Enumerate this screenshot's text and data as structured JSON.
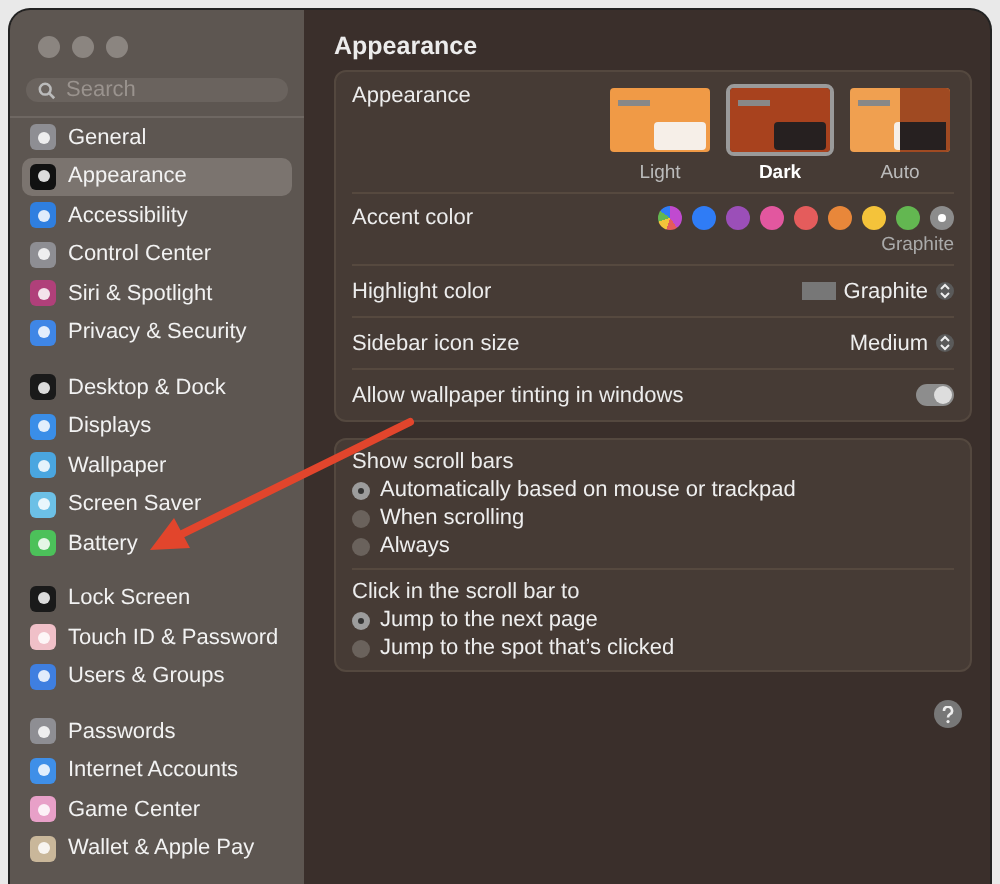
{
  "sidebar": {
    "search": {
      "placeholder": "Search"
    },
    "groups": [
      {
        "items": [
          {
            "label": "General",
            "color": "#8e8e93",
            "selected": false
          },
          {
            "label": "Appearance",
            "color": "#111111",
            "selected": true
          },
          {
            "label": "Accessibility",
            "color": "#2f7fe0",
            "selected": false
          },
          {
            "label": "Control Center",
            "color": "#8e8e93",
            "selected": false
          },
          {
            "label": "Siri & Spotlight",
            "color": "#b0407a",
            "selected": false
          },
          {
            "label": "Privacy & Security",
            "color": "#3f86e6",
            "selected": false
          }
        ]
      },
      {
        "items": [
          {
            "label": "Desktop & Dock",
            "color": "#1a1a1a",
            "selected": false
          },
          {
            "label": "Displays",
            "color": "#3a8ee8",
            "selected": false
          },
          {
            "label": "Wallpaper",
            "color": "#4aa6e0",
            "selected": false
          },
          {
            "label": "Screen Saver",
            "color": "#6cc0e6",
            "selected": false
          },
          {
            "label": "Battery",
            "color": "#4cc15a",
            "selected": false
          }
        ]
      },
      {
        "items": [
          {
            "label": "Lock Screen",
            "color": "#1a1a1a",
            "selected": false
          },
          {
            "label": "Touch ID & Password",
            "color": "#f0c0c8",
            "selected": false
          },
          {
            "label": "Users & Groups",
            "color": "#3f7fe0",
            "selected": false
          }
        ]
      },
      {
        "items": [
          {
            "label": "Passwords",
            "color": "#8e8e93",
            "selected": false
          },
          {
            "label": "Internet Accounts",
            "color": "#3f8fe8",
            "selected": false
          },
          {
            "label": "Game Center",
            "color": "#e8a0c8",
            "selected": false
          },
          {
            "label": "Wallet & Apple Pay",
            "color": "#c9b79a",
            "selected": false
          }
        ]
      }
    ]
  },
  "content": {
    "title": "Appearance",
    "appearance": {
      "label": "Appearance",
      "options": [
        {
          "label": "Light",
          "kind": "light",
          "selected": false
        },
        {
          "label": "Dark",
          "kind": "dark",
          "selected": true
        },
        {
          "label": "Auto",
          "kind": "auto",
          "selected": false
        }
      ]
    },
    "accent": {
      "label": "Accent color",
      "caption": "Graphite",
      "colors": [
        {
          "kind": "multicolor",
          "color": "#c04ad0",
          "selected": false
        },
        {
          "kind": "solid",
          "color": "#2f7cf6",
          "selected": false
        },
        {
          "kind": "solid",
          "color": "#9b4fb8",
          "selected": false
        },
        {
          "kind": "solid",
          "color": "#e2579f",
          "selected": false
        },
        {
          "kind": "solid",
          "color": "#e45c5c",
          "selected": false
        },
        {
          "kind": "solid",
          "color": "#e8873a",
          "selected": false
        },
        {
          "kind": "solid",
          "color": "#f4c33a",
          "selected": false
        },
        {
          "kind": "solid",
          "color": "#63b751",
          "selected": false
        },
        {
          "kind": "solid",
          "color": "#8c8c8c",
          "selected": true
        }
      ]
    },
    "highlight": {
      "label": "Highlight color",
      "value": "Graphite"
    },
    "icon_size": {
      "label": "Sidebar icon size",
      "value": "Medium"
    },
    "tinting": {
      "label": "Allow wallpaper tinting in windows",
      "on": true
    },
    "radio_groups": [
      {
        "label": "Show scroll bars",
        "options": [
          {
            "label": "Automatically based on mouse or trackpad",
            "selected": true
          },
          {
            "label": "When scrolling",
            "selected": false
          },
          {
            "label": "Always",
            "selected": false
          }
        ]
      },
      {
        "label": "Click in the scroll bar to",
        "options": [
          {
            "label": "Jump to the next page",
            "selected": true
          },
          {
            "label": "Jump to the spot that’s clicked",
            "selected": false
          }
        ]
      }
    ]
  }
}
